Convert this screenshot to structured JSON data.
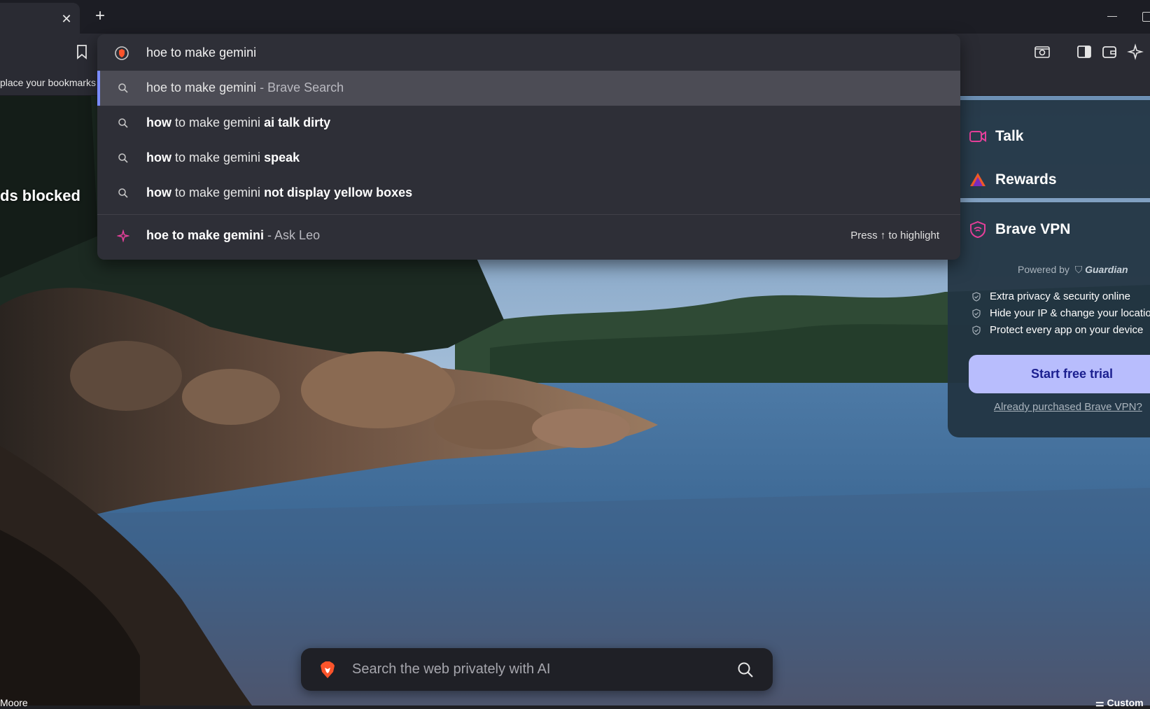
{
  "tabstrip": {
    "close_glyph": "✕",
    "new_tab_glyph": "+"
  },
  "bookmarks_bar": {
    "hint": "place your bookmarks here"
  },
  "omnibox": {
    "value": "hoe to make gemini",
    "suggestions": [
      {
        "bold": "",
        "plain": "hoe to make gemini",
        "tail_bold": "",
        "suffix": " - Brave Search",
        "selected": true,
        "icon": "search-icon"
      },
      {
        "bold": "how",
        "plain": " to make gemini ",
        "tail_bold": "ai talk dirty",
        "suffix": "",
        "selected": false,
        "icon": "search-icon"
      },
      {
        "bold": "how",
        "plain": " to make gemini ",
        "tail_bold": "speak",
        "suffix": "",
        "selected": false,
        "icon": "search-icon"
      },
      {
        "bold": "how",
        "plain": " to make gemini ",
        "tail_bold": "not display yellow boxes",
        "suffix": "",
        "selected": false,
        "icon": "search-icon"
      }
    ],
    "leo": {
      "query": "hoe to make gemini",
      "suffix": " - Ask Leo",
      "hint": "Press ↑ to highlight",
      "icon": "leo-sparkle-icon"
    }
  },
  "stats": {
    "ads_blocked": "ds blocked"
  },
  "cards": {
    "talk": "Talk",
    "rewards": "Rewards",
    "vpn": {
      "title": "Brave VPN",
      "powered_by": "Powered by",
      "partner": "Guardian",
      "features": [
        "Extra privacy & security online",
        "Hide your IP & change your location",
        "Protect every app on your device"
      ],
      "cta": "Start free trial",
      "already": "Already purchased Brave VPN?"
    }
  },
  "search_box": {
    "placeholder": "Search the web privately with AI"
  },
  "footer": {
    "more": "Moore",
    "customize": "Custom"
  },
  "colors": {
    "accent_selected": "#7a8cff",
    "cta_bg": "#b8bdfd",
    "cta_text": "#1b1f8f",
    "talk_icon": "#e6409b",
    "vpn_icon": "#e6409b"
  }
}
